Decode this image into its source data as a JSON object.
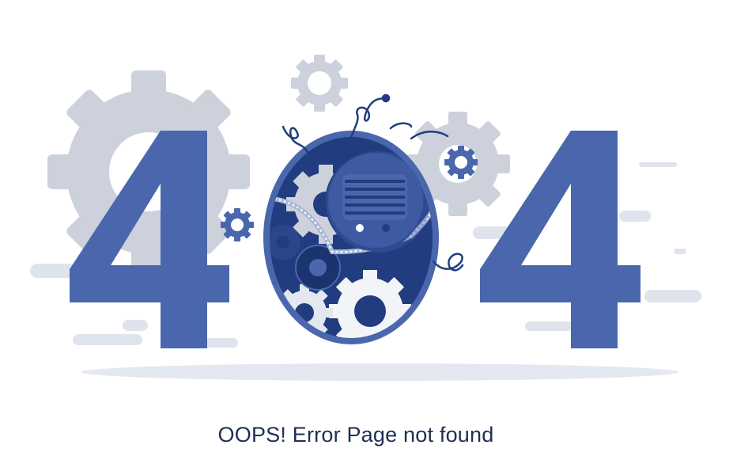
{
  "message": {
    "text": "OOPS! Error Page not found"
  },
  "colors": {
    "primary_blue": "#4a67ad",
    "dark_blue": "#213d80",
    "gear_gray": "#ccd1dc",
    "light_gray": "#dfe3ec",
    "text": "#1f2f52"
  },
  "illustration": {
    "digits": [
      "4",
      "0",
      "4"
    ],
    "icons": [
      "large-gear-icon",
      "small-gear-icon",
      "robot-head-icon",
      "antenna-icon"
    ]
  }
}
